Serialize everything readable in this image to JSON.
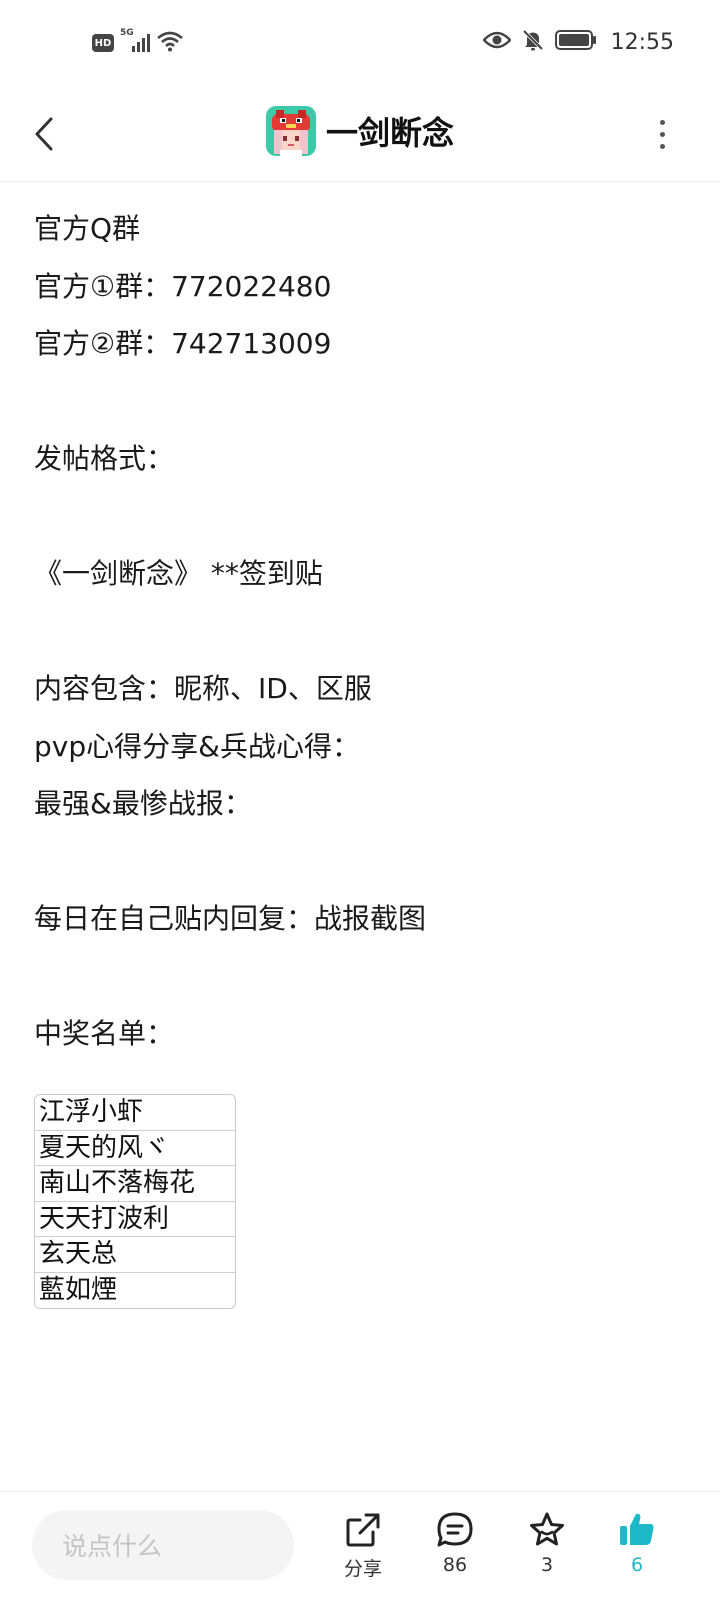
{
  "status_bar": {
    "hd": "HD",
    "network": "5G",
    "time": "12:55"
  },
  "header": {
    "title": "一剑断念",
    "back_icon": "chevron-left-icon",
    "more_icon": "more-vertical-icon"
  },
  "post": {
    "lines": [
      "官方Q群",
      "官方①群：772022480",
      "官方②群：742713009",
      "",
      "发帖格式：",
      "",
      "《一剑断念》 **签到贴",
      "",
      "内容包含：昵称、ID、区服",
      "pvp心得分享&兵战心得：",
      "最强&最惨战报：",
      "",
      "每日在自己贴内回复：战报截图",
      "",
      "中奖名单："
    ],
    "winners": [
      "江浮小虾",
      "夏天的风ヾ",
      "南山不落梅花",
      "天天打波利",
      "玄天总",
      "藍如煙"
    ]
  },
  "bottom_bar": {
    "comment_placeholder": "说点什么",
    "share_label": "分享",
    "comments_count": "86",
    "favorites_count": "3",
    "likes_count": "6",
    "accent_color": "#1fb8c8"
  }
}
